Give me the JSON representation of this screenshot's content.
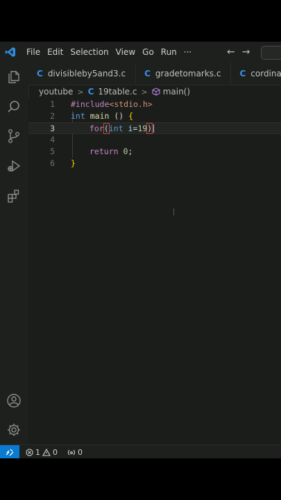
{
  "menu": [
    "File",
    "Edit",
    "Selection",
    "View",
    "Go",
    "Run"
  ],
  "menu_more": "···",
  "nav": {
    "back": "←",
    "forward": "→"
  },
  "tabs": [
    {
      "icon": "C",
      "label": "divisibleby5and3.c"
    },
    {
      "icon": "C",
      "label": "gradetomarks.c"
    },
    {
      "icon": "C",
      "label": "cordinates."
    }
  ],
  "breadcrumb": {
    "folder": "youtube",
    "sep": ">",
    "file_icon": "C",
    "file": "19table.c",
    "symbol": "main()"
  },
  "editor": {
    "line_numbers": [
      "1",
      "2",
      "3",
      "4",
      "5",
      "6"
    ],
    "active_line": "3",
    "lines": {
      "l1": {
        "directive": "#include",
        "header": "<stdio.h>"
      },
      "l2": {
        "type": "int",
        "fn": "main",
        "rest": " () ",
        "brace": "{"
      },
      "l3": {
        "kw": "for",
        "open": "(",
        "type": "int",
        "var": "i",
        "eq": "=",
        "num": "19",
        "close": ")"
      },
      "l4": {},
      "l5": {
        "kw": "return",
        "num": "0",
        "semi": ";"
      },
      "l6": {
        "brace": "}"
      }
    }
  },
  "status": {
    "errors": "1",
    "warnings": "0",
    "ports": "0"
  },
  "icons": {
    "remote": "remote-icon",
    "explorer": "files-icon",
    "search": "search-icon",
    "scm": "source-control-icon",
    "debug": "run-debug-icon",
    "extensions": "extensions-icon",
    "account": "account-icon",
    "settings": "gear-icon"
  },
  "colors": {
    "accent": "#0b7ad1",
    "c_icon": "#3b8eea",
    "background": "#1b1d1b"
  }
}
